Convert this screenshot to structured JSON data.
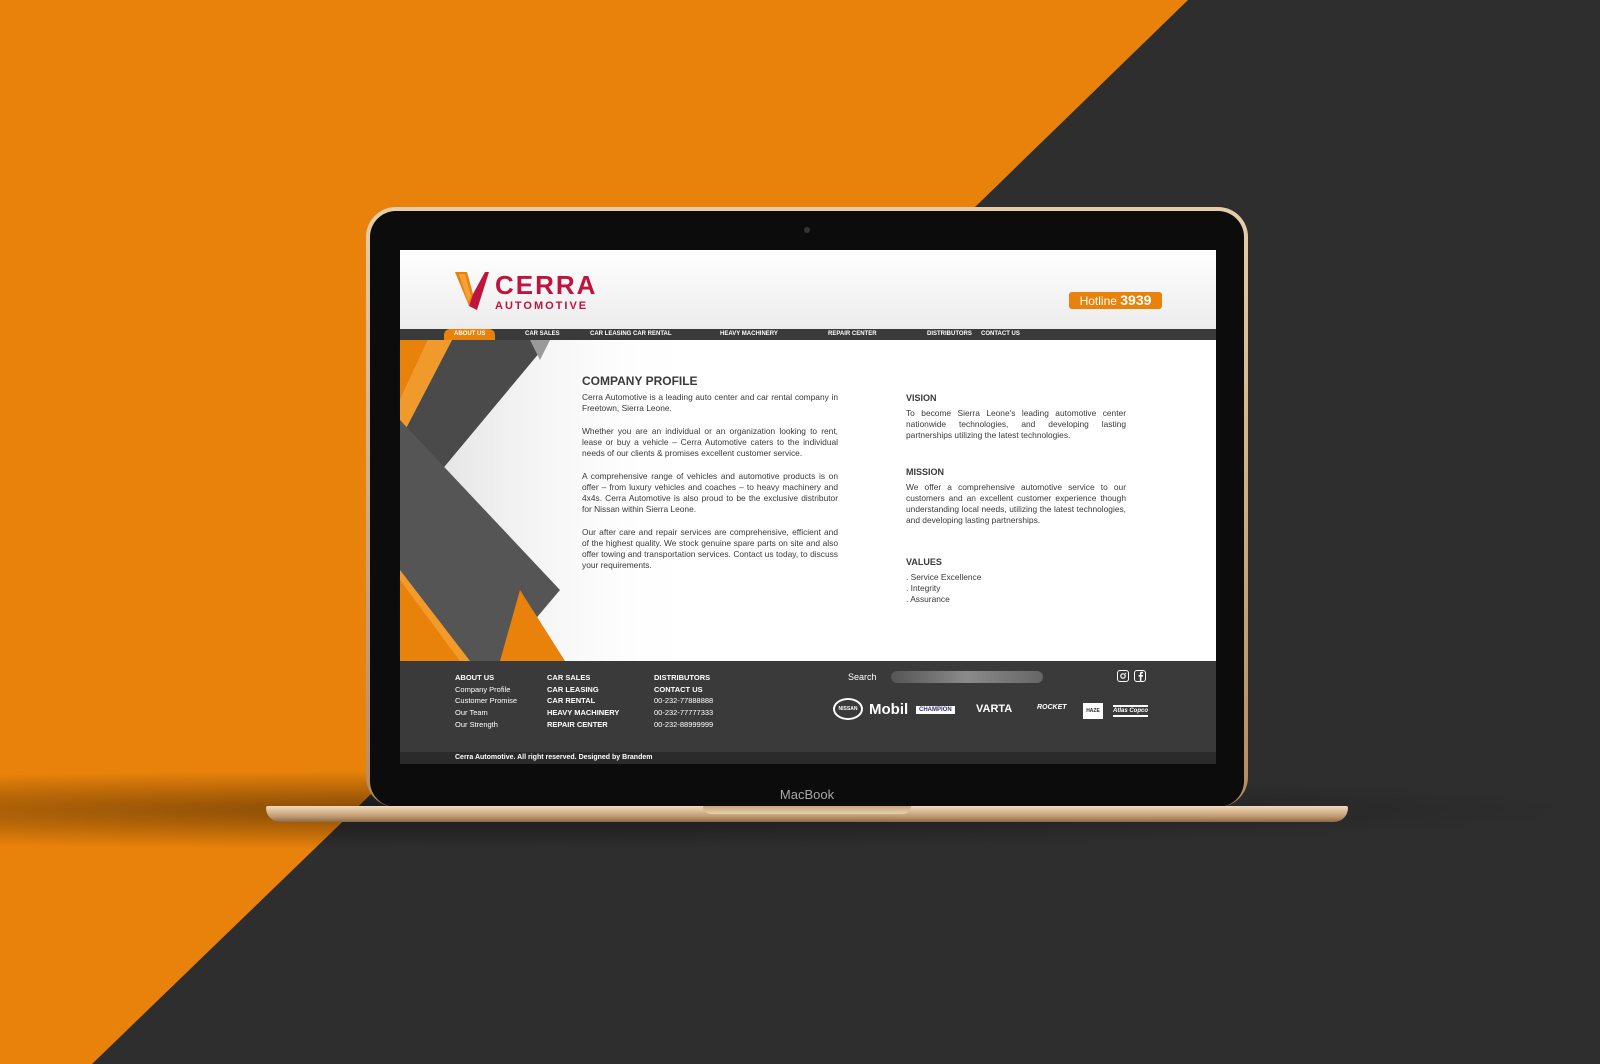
{
  "colors": {
    "orange": "#e8820a",
    "dark": "#3a3a3a",
    "brand_red": "#c0143c"
  },
  "device": {
    "label": "MacBook"
  },
  "logo": {
    "word": "CERRA",
    "sub": "AUTOMOTIVE"
  },
  "hotline": {
    "label": "Hotline",
    "number": "3939"
  },
  "nav": {
    "items": [
      "ABOUT US",
      "CAR SALES",
      "CAR LEASING CAR RENTAL",
      "HEAVY MACHINERY",
      "REPAIR CENTER",
      "DISTRIBUTORS",
      "CONTACT US"
    ],
    "active": "ABOUT US"
  },
  "profile": {
    "title": "COMPANY PROFILE",
    "paragraphs": [
      "Cerra Automotive is a leading auto center and car rental company in Freetown, Sierra Leone.",
      "Whether you are an individual or an organization looking to rent, lease or buy a vehicle – Cerra Automotive caters to the individual needs of our clients & promises excellent customer service.",
      "A comprehensive range of vehicles and automotive products is on offer – from luxury vehicles and coaches – to heavy machinery and 4x4s. Cerra Automotive is also proud to be the exclusive distributor for Nissan within Sierra Leone.",
      "Our after care and repair services are comprehensive, efficient and of the highest quality. We stock genuine spare parts on site and also offer towing and transportation services. Contact us today, to discuss your requirements."
    ]
  },
  "vision": {
    "title": "VISION",
    "text": "To become Sierra Leone's leading automotive center nationwide technologies, and developing lasting partnerships utilizing the latest technologies."
  },
  "mission": {
    "title": "MISSION",
    "text": "We offer a comprehensive automotive service to our customers and an excellent customer experience though understanding local needs, utilizing the latest technologies, and developing lasting partnerships."
  },
  "values": {
    "title": "VALUES",
    "items": [
      ". Service Excellence",
      ". Integrity",
      ". Assurance"
    ]
  },
  "footer": {
    "col1": {
      "title": "ABOUT US",
      "links": [
        "Company Profile",
        "Customer Promise",
        "Our Team",
        "Our Strength"
      ]
    },
    "col2": [
      "CAR SALES",
      "CAR LEASING",
      "CAR RENTAL",
      "HEAVY MACHINERY",
      "REPAIR CENTER"
    ],
    "col3": {
      "titles": [
        "DISTRIBUTORS",
        "CONTACT US"
      ],
      "phones": [
        "00-232-77888888",
        "00-232-77777333",
        "00-232-88999999"
      ]
    },
    "search_label": "Search",
    "social_icons": [
      "instagram-icon",
      "facebook-icon"
    ],
    "brands": [
      "NISSAN",
      "Mobil",
      "CHAMPION",
      "VARTA",
      "ROCKET",
      "HAZE",
      "Atlas Copco"
    ],
    "copyright": "Cerra Automotive. All right reserved. Designed by Brandem"
  }
}
